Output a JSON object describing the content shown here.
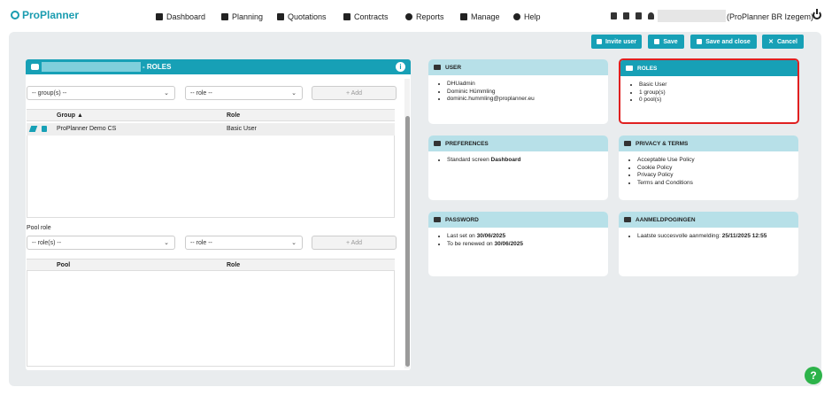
{
  "app": {
    "name": "ProPlanner"
  },
  "nav": {
    "items": [
      {
        "label": "Dashboard"
      },
      {
        "label": "Planning"
      },
      {
        "label": "Quotations"
      },
      {
        "label": "Contracts"
      },
      {
        "label": "Reports"
      },
      {
        "label": "Manage"
      },
      {
        "label": "Help"
      }
    ]
  },
  "topright": {
    "user_name": "(ProPlanner BR Izegem)"
  },
  "toolbar": {
    "invite_label": "Invite user",
    "save_label": "Save",
    "save_close_label": "Save and close",
    "cancel_label": "Cancel"
  },
  "roles_panel": {
    "title": "- ROLES",
    "group_select": "-- group(s) --",
    "role_select": "-- role --",
    "add_label": "+ Add",
    "group_table": {
      "headers": [
        "Group ▲",
        "Role"
      ],
      "rows": [
        {
          "group": "ProPlanner Demo CS",
          "role": "Basic User"
        }
      ]
    },
    "pool_role_label": "Pool role",
    "pool_select": "-- role(s) --",
    "pool_role_select": "-- role --",
    "pool_add_label": "+ Add",
    "pool_table": {
      "headers": [
        "Pool",
        "Role"
      ]
    }
  },
  "cards": {
    "user": {
      "title": "USER",
      "items": [
        "DHUadmin",
        "Dominic Hümmling",
        "dominic.hummling@proplanner.eu"
      ]
    },
    "roles": {
      "title": "ROLES",
      "items": [
        "Basic User",
        "1 group(s)",
        "0 pool(s)"
      ]
    },
    "preferences": {
      "title": "PREFERENCES",
      "item_prefix": "Standard screen",
      "item_value": "Dashboard"
    },
    "privacy": {
      "title": "PRIVACY & TERMS",
      "items": [
        "Acceptable Use Policy",
        "Cookie Policy",
        "Privacy Policy",
        "Terms and Conditions"
      ]
    },
    "password": {
      "title": "PASSWORD",
      "lines": [
        {
          "prefix": "Last set on",
          "value": "30/06/2025"
        },
        {
          "prefix": "To be renewed on",
          "value": "30/06/2025"
        }
      ]
    },
    "login_attempts": {
      "title": "AANMELDPOGINGEN",
      "prefix": "Laatste succesvolle aanmelding:",
      "value": "25/11/2025 12:55"
    }
  },
  "help": {
    "label": "?"
  }
}
